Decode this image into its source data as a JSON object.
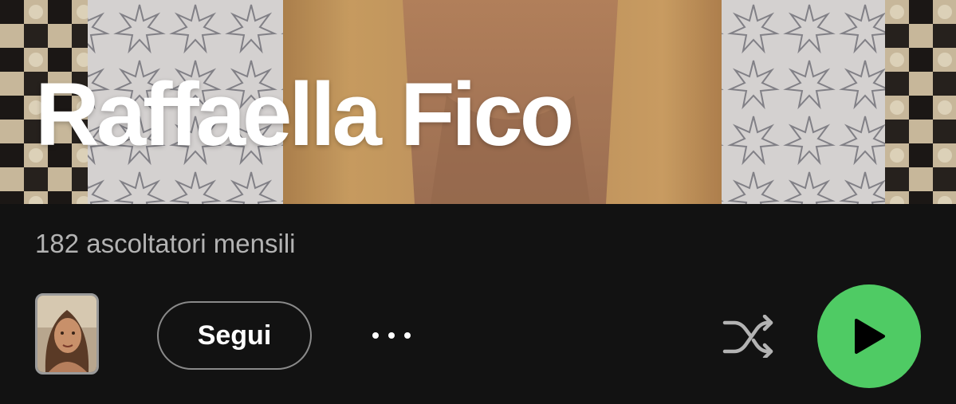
{
  "artist": {
    "name": "Raffaella Fico",
    "monthly_listeners": "182 ascoltatori mensili"
  },
  "actions": {
    "follow_label": "Segui",
    "more_icon": "more-dots-icon",
    "shuffle_icon": "shuffle-icon",
    "play_icon": "play-icon"
  },
  "colors": {
    "background": "#121212",
    "play_accent": "#4fcb64",
    "secondary_text": "#b3b3b3",
    "primary_text": "#ffffff"
  }
}
